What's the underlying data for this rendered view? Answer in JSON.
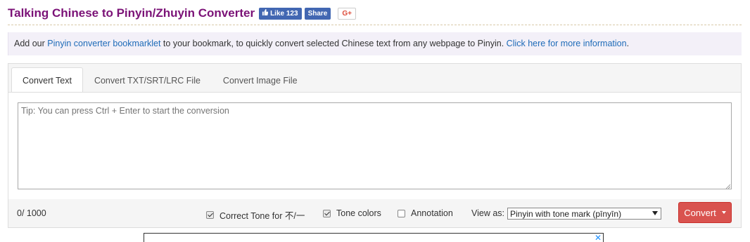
{
  "header": {
    "title": "Talking Chinese to Pinyin/Zhuyin Converter",
    "fb_like_label": "Like 123",
    "fb_share_label": "Share",
    "gplus_label": "G+"
  },
  "notice": {
    "prefix": "Add our ",
    "link1": "Pinyin converter bookmarklet",
    "middle": " to your bookmark, to quickly convert selected Chinese text from any webpage to Pinyin. ",
    "link2": "Click here for more information",
    "suffix": "."
  },
  "tabs": [
    {
      "label": "Convert Text",
      "active": true
    },
    {
      "label": "Convert TXT/SRT/LRC File",
      "active": false
    },
    {
      "label": "Convert Image File",
      "active": false
    }
  ],
  "input": {
    "placeholder": "Tip: You can press Ctrl + Enter to start the conversion",
    "value": ""
  },
  "footer": {
    "counter": "0/ 1000",
    "options": [
      {
        "label": "Correct Tone for 不/一",
        "checked": true
      },
      {
        "label": "Tone colors",
        "checked": true
      },
      {
        "label": "Annotation",
        "checked": false
      }
    ],
    "view_as_label": "View as:",
    "view_as_selected": "Pinyin with tone mark (pīnyīn)",
    "convert_label": "Convert"
  },
  "ad": {
    "close_label": "✕"
  },
  "colors": {
    "title": "#7b1277",
    "link": "#1e6bb8",
    "convert_button": "#d9534f",
    "facebook": "#4267b2"
  }
}
